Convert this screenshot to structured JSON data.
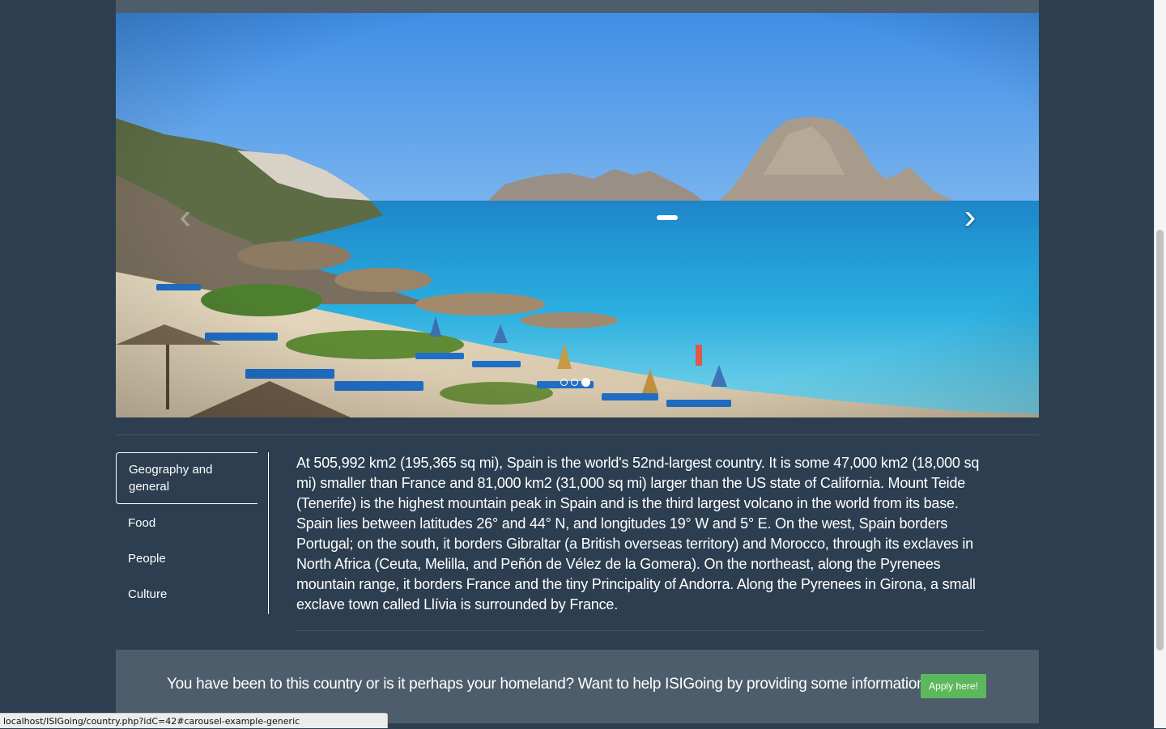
{
  "carousel": {
    "prev_icon": "chevron-left-icon",
    "next_icon": "chevron-right-icon",
    "prev_glyph": "‹",
    "next_glyph": "›",
    "slide_count": 3,
    "active_index": 2
  },
  "tabs": [
    {
      "label": "Geography and general",
      "active": true
    },
    {
      "label": "Food",
      "active": false
    },
    {
      "label": "People",
      "active": false
    },
    {
      "label": "Culture",
      "active": false
    }
  ],
  "content": {
    "text": "At 505,992 km2 (195,365 sq mi), Spain is the world's 52nd-largest country. It is some 47,000 km2 (18,000 sq mi) smaller than France and 81,000 km2 (31,000 sq mi) larger than the US state of California. Mount Teide (Tenerife) is the highest mountain peak in Spain and is the third largest volcano in the world from its base. Spain lies between latitudes 26° and 44° N, and longitudes 19° W and 5° E. On the west, Spain borders Portugal; on the south, it borders Gibraltar (a British overseas territory) and Morocco, through its exclaves in North Africa (Ceuta, Melilla, and Peñón de Vélez de la Gomera). On the northeast, along the Pyrenees mountain range, it borders France and the tiny Principality of Andorra. Along the Pyrenees in Girona, a small exclave town called Llívia is surrounded by France."
  },
  "cta": {
    "text": "You have been to this country or is it perhaps your homeland? Want to help ISIGoing by providing some information?",
    "button_label": "Apply here!"
  },
  "status_bar": {
    "url": "localhost/ISIGoing/country.php?idC=42#carousel-example-generic"
  },
  "colors": {
    "background": "#2c3e50",
    "panel": "#4e5d6c",
    "accent_green": "#5cb85c"
  }
}
